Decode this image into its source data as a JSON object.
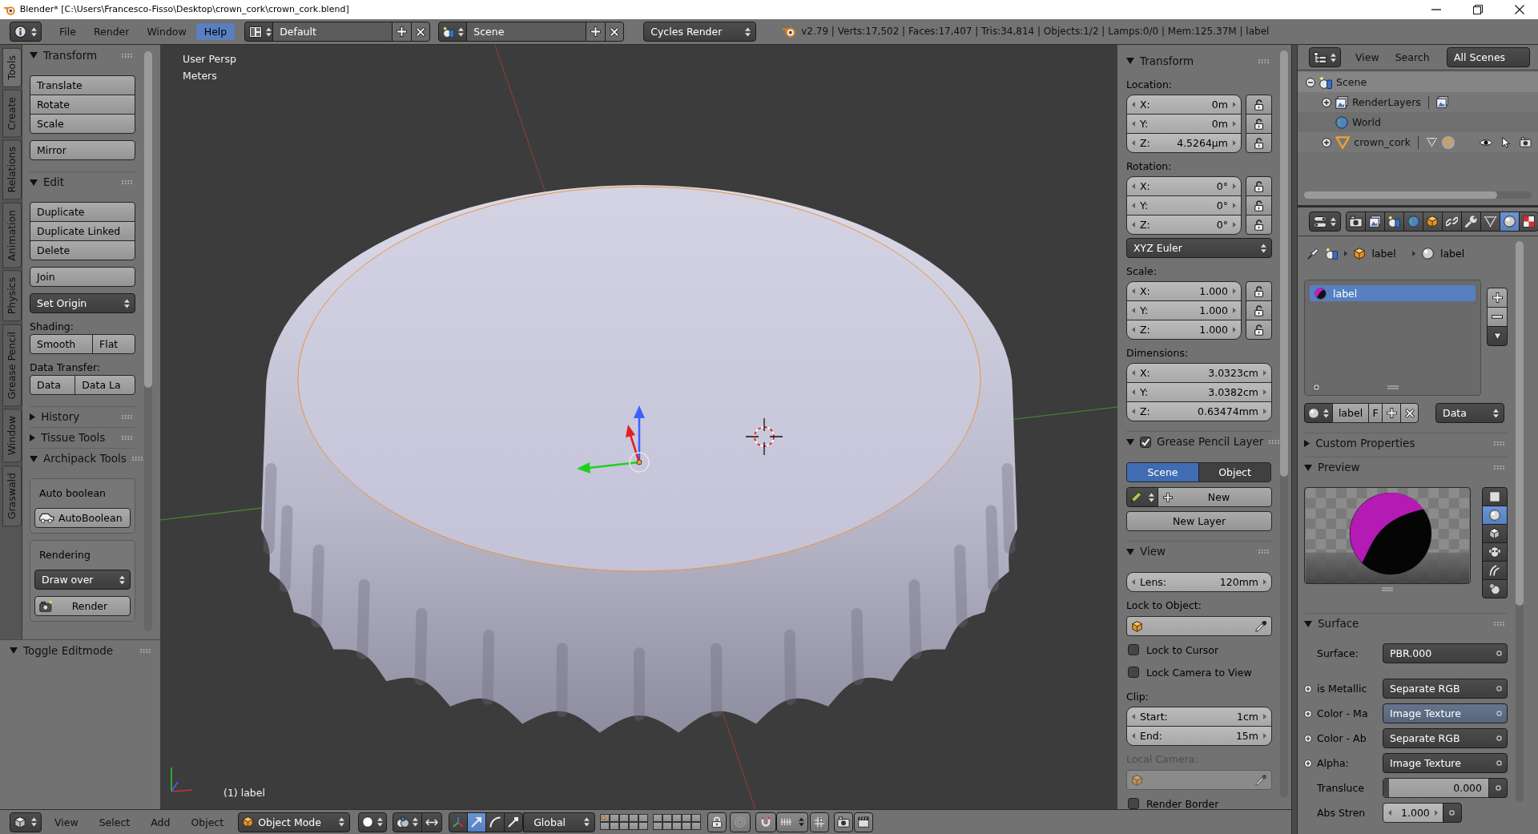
{
  "title_bar": {
    "title": "Blender* [C:\\Users\\Francesco-Fisso\\Desktop\\crown_cork\\crown_cork.blend]"
  },
  "info_header": {
    "menus": [
      {
        "label": "File",
        "highlighted": false
      },
      {
        "label": "Render",
        "highlighted": false
      },
      {
        "label": "Window",
        "highlighted": false
      },
      {
        "label": "Help",
        "highlighted": true
      }
    ],
    "screen_layout": "Default",
    "scene": "Scene",
    "render_engine": "Cycles Render",
    "stats": "v2.79 | Verts:17,502 | Faces:17,407 | Tris:34,814 | Objects:1/2 | Lamps:0/0 | Mem:125.37M | label"
  },
  "tool_tabs": [
    {
      "label": "Tools",
      "selected": true
    },
    {
      "label": "Create",
      "selected": false
    },
    {
      "label": "Relations",
      "selected": false
    },
    {
      "label": "Animation",
      "selected": false
    },
    {
      "label": "Physics",
      "selected": false
    },
    {
      "label": "Grease Pencil",
      "selected": false
    },
    {
      "label": "Window",
      "selected": false
    },
    {
      "label": "Graswald",
      "selected": false
    }
  ],
  "tool_panels": [
    {
      "title": "Transform",
      "expanded": true,
      "items": [
        {
          "kind": "buttons",
          "labels": [
            "Translate",
            "Rotate",
            "Scale"
          ]
        },
        {
          "kind": "buttons",
          "labels": [
            "Mirror"
          ]
        }
      ]
    },
    {
      "title": "Edit",
      "expanded": true,
      "items": [
        {
          "kind": "buttons",
          "labels": [
            "Duplicate",
            "Duplicate Linked",
            "Delete"
          ]
        },
        {
          "kind": "buttons",
          "labels": [
            "Join"
          ]
        },
        {
          "kind": "dropdown",
          "value": "Set Origin"
        },
        {
          "kind": "label",
          "text": "Shading:"
        },
        {
          "kind": "button_row",
          "labels": [
            "Smooth",
            "Flat"
          ]
        },
        {
          "kind": "label",
          "text": "Data Transfer:"
        },
        {
          "kind": "button_row",
          "labels": [
            "Data",
            "Data La"
          ]
        }
      ]
    },
    {
      "title": "History",
      "expanded": false
    },
    {
      "title": "Tissue Tools",
      "expanded": false
    },
    {
      "title": "Archipack Tools",
      "expanded": true,
      "items": [
        {
          "kind": "box",
          "items": [
            {
              "kind": "label",
              "text": "Auto boolean"
            },
            {
              "kind": "boolean_button",
              "label": "AutoBoolean"
            }
          ]
        },
        {
          "kind": "box",
          "items": [
            {
              "kind": "label",
              "text": "Rendering"
            },
            {
              "kind": "dropdown",
              "value": "Draw over"
            },
            {
              "kind": "render_button",
              "label": "Render"
            }
          ]
        }
      ]
    }
  ],
  "redo_panel": {
    "title": "Toggle Editmode",
    "expanded": true
  },
  "viewport": {
    "view_name": "User Persp",
    "units": "Meters",
    "object_info": "(1) label"
  },
  "n_panel": [
    {
      "title": "Transform",
      "expanded": true,
      "items": [
        {
          "kind": "label",
          "text": "Location:",
          "disabled": false
        },
        {
          "kind": "vector",
          "fields": [
            {
              "name": "X:",
              "value": "0m",
              "locked": false
            },
            {
              "name": "Y:",
              "value": "0m",
              "locked": false
            },
            {
              "name": "Z:",
              "value": "4.5264µm",
              "locked": false
            }
          ]
        },
        {
          "kind": "label",
          "text": "Rotation:",
          "disabled": false
        },
        {
          "kind": "vector",
          "fields": [
            {
              "name": "X:",
              "value": "0°",
              "locked": false
            },
            {
              "name": "Y:",
              "value": "0°",
              "locked": false
            },
            {
              "name": "Z:",
              "value": "0°",
              "locked": false
            }
          ]
        },
        {
          "kind": "dropdown",
          "value": "XYZ Euler"
        },
        {
          "kind": "label",
          "text": "Scale:",
          "disabled": false
        },
        {
          "kind": "vector",
          "fields": [
            {
              "name": "X:",
              "value": "1.000",
              "locked": false
            },
            {
              "name": "Y:",
              "value": "1.000",
              "locked": false
            },
            {
              "name": "Z:",
              "value": "1.000",
              "locked": false
            }
          ]
        },
        {
          "kind": "label",
          "text": "Dimensions:",
          "disabled": false
        },
        {
          "kind": "vector",
          "fields": [
            {
              "name": "X:",
              "value": "3.0323cm"
            },
            {
              "name": "Y:",
              "value": "3.0382cm"
            },
            {
              "name": "Z:",
              "value": "0.63474mm"
            }
          ]
        }
      ]
    },
    {
      "title": "Grease Pencil Layer",
      "expanded": true,
      "checked": true,
      "items": [
        {
          "kind": "toggle_row",
          "options": [
            {
              "label": "Scene",
              "selected": true
            },
            {
              "label": "Object",
              "selected": false
            }
          ]
        },
        {
          "kind": "new_row",
          "label": "New"
        },
        {
          "kind": "button",
          "label": "New Layer"
        }
      ]
    },
    {
      "title": "View",
      "expanded": true,
      "items": [
        {
          "kind": "number",
          "name": "Lens:",
          "value": "120mm"
        },
        {
          "kind": "label",
          "text": "Lock to Object:",
          "disabled": false
        },
        {
          "kind": "object_field",
          "disabled": false
        },
        {
          "kind": "checkbox",
          "label": "Lock to Cursor",
          "checked": false
        },
        {
          "kind": "checkbox",
          "label": "Lock Camera to View",
          "checked": false
        },
        {
          "kind": "label",
          "text": "Clip:",
          "disabled": false
        },
        {
          "kind": "vector",
          "fields": [
            {
              "name": "Start:",
              "value": "1cm"
            },
            {
              "name": "End:",
              "value": "15m"
            }
          ]
        },
        {
          "kind": "label",
          "text": "Local Camera:",
          "disabled": true
        },
        {
          "kind": "object_field",
          "disabled": true
        },
        {
          "kind": "checkbox",
          "label": "Render Border",
          "checked": false
        }
      ]
    }
  ],
  "outliner": {
    "menus": [
      "View",
      "Search"
    ],
    "filter": "All Scenes",
    "tree": [
      {
        "kind": "scene",
        "label": "Scene",
        "expanded": true,
        "selected": true,
        "children": [
          {
            "kind": "render_layers",
            "label": "RenderLayers",
            "expanded": false,
            "selected": false
          },
          {
            "kind": "world",
            "label": "World",
            "selected": false
          },
          {
            "kind": "object",
            "label": "crown_cork",
            "expanded": false,
            "selected": false
          }
        ]
      }
    ]
  },
  "properties": {
    "tabs": [
      {
        "kind": "render",
        "selected": false
      },
      {
        "kind": "render_layers",
        "selected": false
      },
      {
        "kind": "scene",
        "selected": false
      },
      {
        "kind": "world",
        "selected": false
      },
      {
        "kind": "object",
        "selected": false
      },
      {
        "kind": "constraints",
        "selected": false
      },
      {
        "kind": "modifiers",
        "selected": false
      },
      {
        "kind": "data",
        "selected": false
      },
      {
        "kind": "material",
        "selected": true
      },
      {
        "kind": "texture",
        "selected": false
      }
    ],
    "breadcrumb": {
      "object": "label",
      "material": "label"
    },
    "material_slots": [
      {
        "name": "label",
        "selected": true
      }
    ],
    "material": {
      "name": "label",
      "fake_user": "F",
      "link": "Data"
    },
    "panels": [
      {
        "title": "Custom Properties",
        "expanded": false
      },
      {
        "kind": "preview",
        "title": "Preview",
        "expanded": true,
        "shapes": [
          {
            "kind": "plane",
            "selected": false
          },
          {
            "kind": "sphere",
            "selected": true
          },
          {
            "kind": "cube",
            "selected": false
          },
          {
            "kind": "monkey",
            "selected": false
          },
          {
            "kind": "hair",
            "selected": false
          },
          {
            "kind": "sky",
            "selected": false
          }
        ]
      },
      {
        "kind": "surface",
        "title": "Surface",
        "expanded": true,
        "rows": [
          {
            "kind": "node",
            "label": "Surface:",
            "value": "PBR.000",
            "highlighted": false
          },
          {
            "kind": "node",
            "label": "is Metallic",
            "value": "Separate RGB",
            "highlighted": false,
            "expanded": false
          },
          {
            "kind": "node",
            "label": "Color - Ma",
            "value": "Image Texture",
            "highlighted": true,
            "expanded": false
          },
          {
            "kind": "node",
            "label": "Color - Ab",
            "value": "Separate RGB",
            "highlighted": false,
            "expanded": false
          },
          {
            "kind": "node",
            "label": "Alpha:",
            "value": "Image Texture",
            "highlighted": false,
            "expanded": false
          },
          {
            "kind": "slider",
            "label": "Transluce",
            "value": "0.000",
            "level": 0
          },
          {
            "kind": "number",
            "label": "Abs Stren",
            "value": "1.000"
          }
        ]
      }
    ]
  },
  "bottom_header": {
    "menus": [
      "View",
      "Select",
      "Add",
      "Object"
    ],
    "mode": "Object Mode",
    "orientation": "Global",
    "manipulators": [
      {
        "kind": "axes",
        "selected": false
      },
      {
        "kind": "translate",
        "selected": true
      },
      {
        "kind": "rotate",
        "selected": false
      },
      {
        "kind": "scale",
        "selected": false
      }
    ],
    "layers": [
      {
        "occupied": true
      },
      {
        "occupied": false
      },
      {
        "occupied": false
      },
      {
        "occupied": false
      },
      {
        "occupied": false
      },
      {
        "occupied": false
      },
      {
        "occupied": false
      },
      {
        "occupied": false
      },
      {
        "occupied": false
      },
      {
        "occupied": false
      },
      {
        "occupied": false
      },
      {
        "occupied": false
      },
      {
        "occupied": false
      },
      {
        "occupied": false
      },
      {
        "occupied": false
      },
      {
        "occupied": false
      },
      {
        "occupied": false
      },
      {
        "occupied": false
      },
      {
        "occupied": false
      },
      {
        "occupied": false
      }
    ]
  }
}
